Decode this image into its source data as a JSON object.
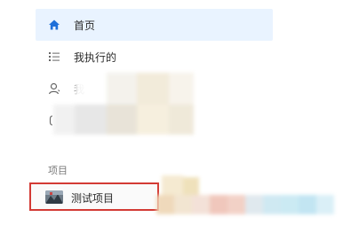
{
  "sidebar": {
    "items": [
      {
        "label": "首页",
        "icon": "home-icon",
        "active": true
      },
      {
        "label": "我执行的",
        "icon": "list-icon",
        "active": false
      },
      {
        "label": "我",
        "icon": "user-icon",
        "active": false
      },
      {
        "label": "",
        "icon": "bracket-icon",
        "active": false
      }
    ],
    "section_title": "项目",
    "projects": [
      {
        "label": "测试项目",
        "icon": "project-thumbnail-icon",
        "highlighted": true
      }
    ]
  },
  "colors": {
    "accent": "#1e6fd9",
    "active_bg": "#e9f3ff",
    "highlight_border": "#d33a34",
    "icon_gray": "#666666"
  }
}
